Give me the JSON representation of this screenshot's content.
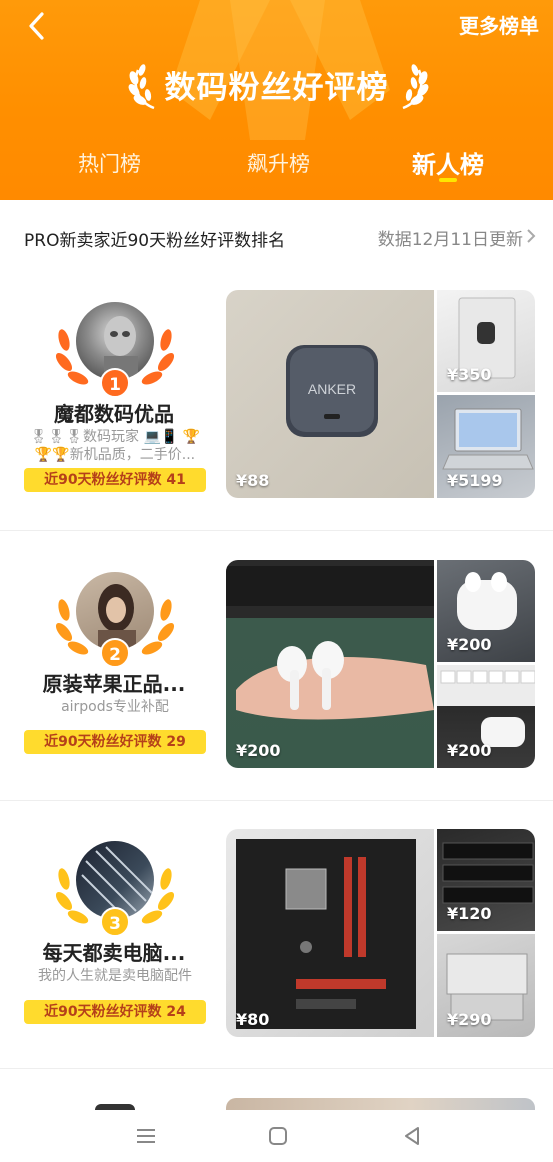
{
  "header": {
    "more_label": "更多榜单",
    "title": "数码粉丝好评榜",
    "tabs": [
      {
        "label": "热门榜"
      },
      {
        "label": "飙升榜"
      },
      {
        "label": "新人榜"
      }
    ],
    "active_tab": "新人榜"
  },
  "subheader": {
    "description": "PRO新卖家近90天粉丝好评数排名",
    "update_text": "数据12月11日更新"
  },
  "sellers": [
    {
      "rank": "1",
      "name": "魔都数码优品",
      "tagline": "🎖🎖🎖数码玩家 💻📱 🏆",
      "tagline2": "🏆🏆新机品质，二手价...",
      "review_label": "近90天粉丝好评数 41",
      "prices": [
        "¥88",
        "¥350",
        "¥5199"
      ],
      "rank_color": "#ff6a1f"
    },
    {
      "rank": "2",
      "name": "原装苹果正品...",
      "tagline": "airpods专业补配",
      "tagline2": "",
      "review_label": "近90天粉丝好评数 29",
      "prices": [
        "¥200",
        "¥200",
        "¥200"
      ],
      "rank_color": "#ff9a1a"
    },
    {
      "rank": "3",
      "name": "每天都卖电脑...",
      "tagline": "我的人生就是卖电脑配件",
      "tagline2": "",
      "review_label": "近90天粉丝好评数 24",
      "prices": [
        "¥80",
        "¥120",
        "¥290"
      ],
      "rank_color": "#ffc21a"
    }
  ],
  "colors": {
    "header_orange": "#ff9000",
    "badge_yellow": "#ffdb2d",
    "tab_indicator": "#ffe600"
  }
}
